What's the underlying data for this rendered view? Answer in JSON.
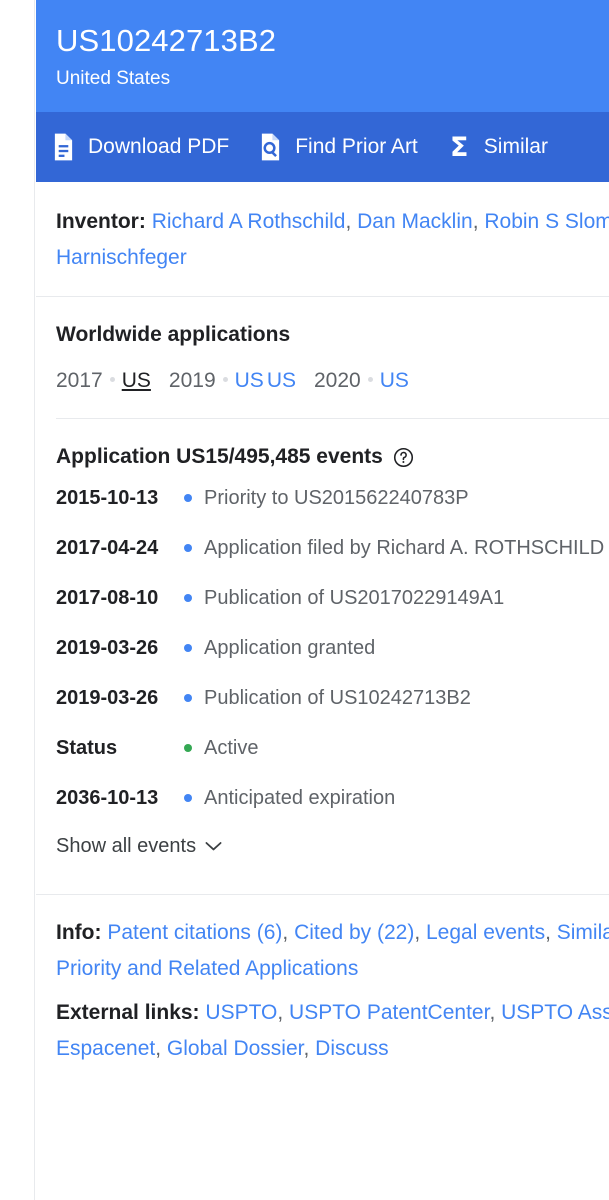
{
  "header": {
    "patent_number": "US10242713B2",
    "country": "United States"
  },
  "action_bar": {
    "items": [
      {
        "label": "Download PDF",
        "icon": "document-download-icon"
      },
      {
        "label": "Find Prior Art",
        "icon": "document-search-icon"
      },
      {
        "label": "Similar",
        "icon": "sigma-icon"
      }
    ]
  },
  "inventor": {
    "label": "Inventor:",
    "names": [
      "Richard A Rothschild",
      "Dan Macklin",
      "Robin S Slomkowski",
      "Taska Harnischfeger"
    ]
  },
  "worldwide": {
    "title": "Worldwide applications",
    "groups": [
      {
        "year": "2017",
        "codes": [
          {
            "code": "US",
            "current": true
          }
        ]
      },
      {
        "year": "2019",
        "codes": [
          {
            "code": "US",
            "current": false
          },
          {
            "code": "US",
            "current": false
          }
        ]
      },
      {
        "year": "2020",
        "codes": [
          {
            "code": "US",
            "current": false
          }
        ]
      }
    ]
  },
  "events": {
    "title": "Application US15/495,485 events",
    "help_icon": "help-circle-icon",
    "rows": [
      {
        "date": "2015-10-13",
        "desc": "Priority to US201562240783P",
        "dot": "blue"
      },
      {
        "date": "2017-04-24",
        "desc": "Application filed by Richard A. ROTHSCHILD",
        "dot": "blue"
      },
      {
        "date": "2017-08-10",
        "desc": "Publication of US20170229149A1",
        "dot": "blue"
      },
      {
        "date": "2019-03-26",
        "desc": "Application granted",
        "dot": "blue"
      },
      {
        "date": "2019-03-26",
        "desc": "Publication of US10242713B2",
        "dot": "blue"
      },
      {
        "date": "Status",
        "desc": "Active",
        "dot": "green"
      },
      {
        "date": "2036-10-13",
        "desc": "Anticipated expiration",
        "dot": "blue"
      }
    ],
    "show_all_label": "Show all events",
    "show_all_icon": "chevron-down-icon"
  },
  "info": {
    "label": "Info:",
    "links": [
      "Patent citations (6)",
      "Cited by (22)",
      "Legal events",
      "Similar documents",
      "Priority and Related Applications"
    ]
  },
  "external": {
    "label": "External links:",
    "links": [
      "USPTO",
      "USPTO PatentCenter",
      "USPTO Assignment",
      "Espacenet",
      "Global Dossier",
      "Discuss"
    ]
  },
  "colors": {
    "header_blue": "#4285f4",
    "action_bar_blue": "#3367d6",
    "link_blue": "#4285f4",
    "text_primary": "#202124",
    "text_secondary": "#5f6368",
    "status_green": "#34a853",
    "divider": "#e8eaed"
  }
}
